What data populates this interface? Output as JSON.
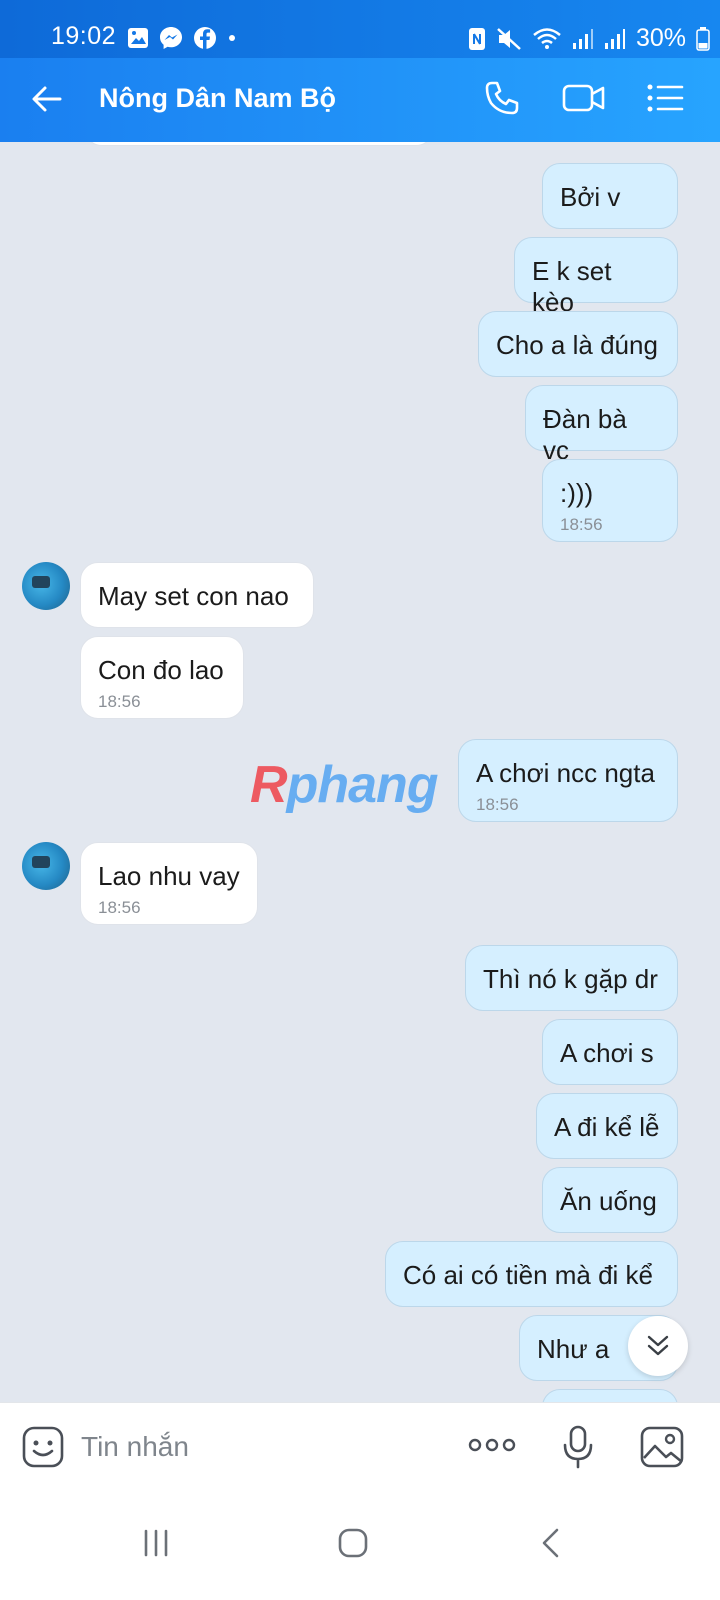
{
  "status_bar": {
    "time": "19:02",
    "battery": "30%",
    "left_icons": [
      "gallery-icon",
      "messenger-icon",
      "facebook-icon",
      "dot-icon"
    ],
    "right_icons": [
      "nfc-icon",
      "mute-icon",
      "wifi-icon",
      "signal-icon",
      "signal-icon",
      "battery-icon"
    ]
  },
  "header": {
    "title": "Nông Dân Nam Bộ",
    "icons": [
      "back-arrow-icon",
      "phone-icon",
      "video-call-icon",
      "menu-icon"
    ]
  },
  "messages": [
    {
      "dir": "out",
      "text": "Bởi v"
    },
    {
      "dir": "out",
      "text": "E k set kèo"
    },
    {
      "dir": "out",
      "text": "Cho a là đúng"
    },
    {
      "dir": "out",
      "text": "Đàn bà vc"
    },
    {
      "dir": "out",
      "text": ":)))",
      "time": "18:56"
    },
    {
      "dir": "in",
      "text": "May set con nao"
    },
    {
      "dir": "in",
      "text": "Con đo lao",
      "time": "18:56"
    },
    {
      "dir": "out",
      "text": "A chơi ncc ngta",
      "time": "18:56"
    },
    {
      "dir": "in",
      "text": "Lao nhu vay",
      "time": "18:56"
    },
    {
      "dir": "out",
      "text": "Thì nó k gặp dr"
    },
    {
      "dir": "out",
      "text": "A chơi s"
    },
    {
      "dir": "out",
      "text": "A đi kể lễ"
    },
    {
      "dir": "out",
      "text": "Ăn uống"
    },
    {
      "dir": "out",
      "text": "Có ai có tiền mà đi kể"
    },
    {
      "dir": "out",
      "text": "Như a"
    }
  ],
  "watermark": {
    "r": "R",
    "rest": "phang"
  },
  "composer": {
    "placeholder": "Tin nhắn",
    "icons": [
      "sticker-icon",
      "more-icon",
      "microphone-icon",
      "image-icon"
    ]
  },
  "nav": {
    "icons": [
      "recents-icon",
      "home-icon",
      "back-icon"
    ]
  },
  "colors": {
    "header": "#1a7ff0",
    "outgoing_bubble": "#d5efff",
    "incoming_bubble": "#ffffff",
    "background": "#e2e7ef"
  }
}
